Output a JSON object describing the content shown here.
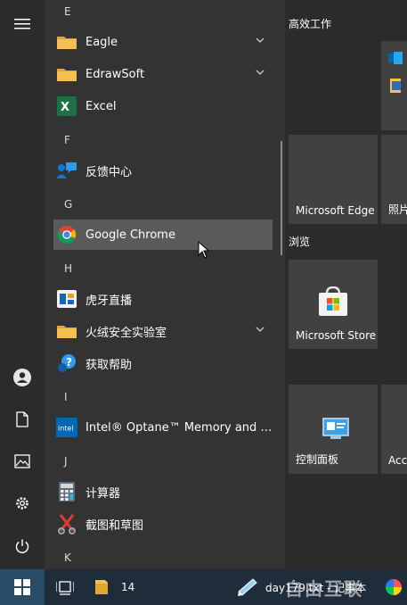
{
  "apps": {
    "letters": [
      "E",
      "F",
      "G",
      "H",
      "I",
      "J",
      "K"
    ],
    "items": [
      {
        "label": "Eagle",
        "icon": "folder-icon",
        "expandable": true
      },
      {
        "label": "EdrawSoft",
        "icon": "folder-icon",
        "expandable": true
      },
      {
        "label": "Excel",
        "icon": "excel-icon",
        "expandable": false
      },
      {
        "label": "反馈中心",
        "icon": "feedback-hub-icon",
        "expandable": false
      },
      {
        "label": "Google Chrome",
        "icon": "chrome-icon",
        "expandable": false,
        "hovered": true
      },
      {
        "label": "虎牙直播",
        "icon": "huya-icon",
        "expandable": false
      },
      {
        "label": "火绒安全实验室",
        "icon": "folder-icon",
        "expandable": true
      },
      {
        "label": "获取帮助",
        "icon": "get-help-icon",
        "expandable": false
      },
      {
        "label": "Intel® Optane™ Memory and Stor...",
        "icon": "intel-icon",
        "expandable": false
      },
      {
        "label": "计算器",
        "icon": "calculator-icon",
        "expandable": false
      },
      {
        "label": "截图和草图",
        "icon": "snip-sketch-icon",
        "expandable": false
      }
    ]
  },
  "tiles": {
    "group1_title": "高效工作",
    "group2_title": "浏览",
    "edge_label": "Microsoft Edge",
    "photos_label": "照片",
    "store_label": "Microsoft Store",
    "control_panel_label": "控制面板",
    "partial_label": "Acc"
  },
  "taskbar": {
    "folder_label": "14",
    "notepad_label": "day179.txt - 记事本",
    "watermark": "自由互联"
  },
  "colors": {
    "folder": "#f2c14e",
    "excel": "#1e7145",
    "accent": "#0078d7",
    "taskbar": "#1f2c3a"
  }
}
